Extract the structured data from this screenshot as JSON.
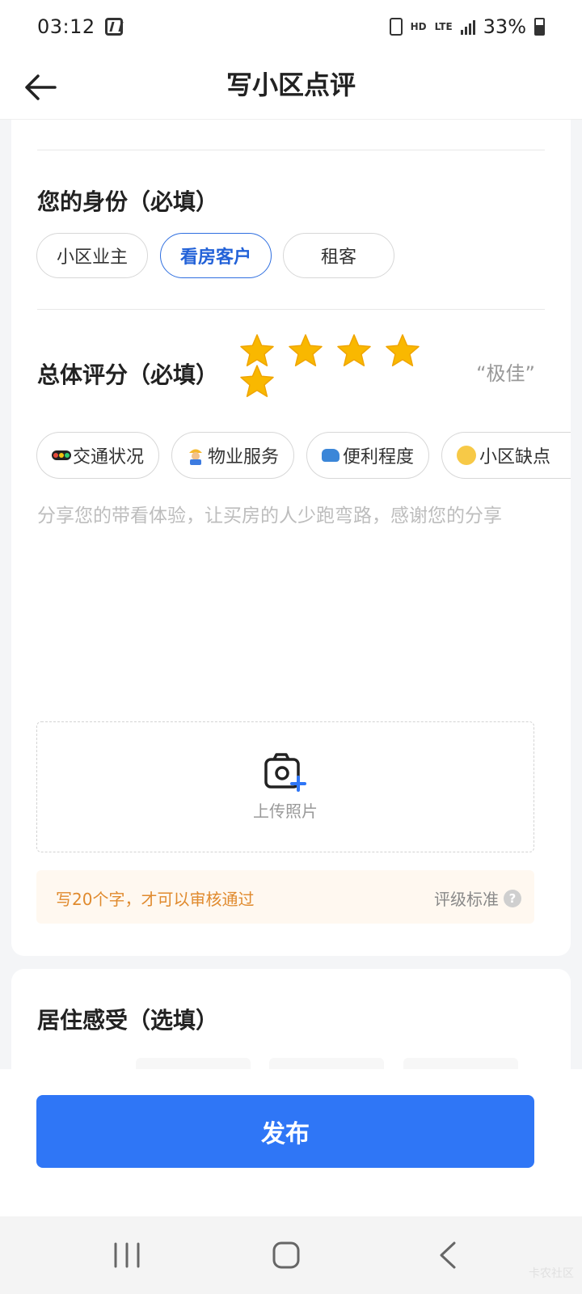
{
  "status_bar": {
    "time": "03:12",
    "hd": "HD",
    "network": "LTE",
    "battery": "33%"
  },
  "header": {
    "title": "写小区点评"
  },
  "identity": {
    "title": "您的身份（必填）",
    "options": [
      "小区业主",
      "看房客户",
      "租客"
    ],
    "selected": "看房客户"
  },
  "rating": {
    "title": "总体评分（必填）",
    "stars": 5,
    "max_stars": 5,
    "label": "“极佳”"
  },
  "tags": [
    {
      "icon": "traffic-light-icon",
      "label": "交通状况"
    },
    {
      "icon": "worker-icon",
      "label": "物业服务"
    },
    {
      "icon": "car-icon",
      "label": "便利程度"
    },
    {
      "icon": "thinking-face-icon",
      "label": "小区缺点"
    }
  ],
  "review": {
    "placeholder": "分享您的带看体验，让买房的人少跑弯路，感谢您的分享",
    "value": ""
  },
  "upload": {
    "label": "上传照片"
  },
  "tip": {
    "text": "写20个字，才可以审核通过",
    "criteria_label": "评级标准",
    "help_glyph": "?"
  },
  "living": {
    "title": "居住感受（选填）"
  },
  "publish": {
    "label": "发布"
  },
  "watermark": "卡农社区",
  "colors": {
    "accent": "#2f76f6",
    "selected_text": "#2362d8",
    "star": "#f9b800",
    "tip_text": "#e08a2e",
    "tip_bg": "#fff8f0"
  }
}
